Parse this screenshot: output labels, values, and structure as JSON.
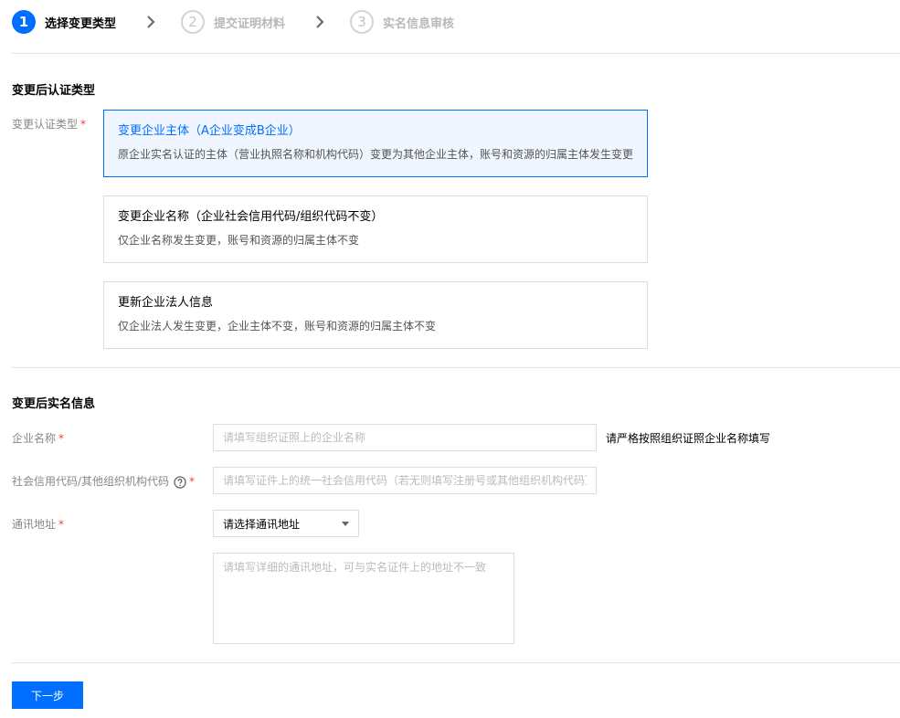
{
  "steps": [
    {
      "number": "1",
      "label": "选择变更类型"
    },
    {
      "number": "2",
      "label": "提交证明材料"
    },
    {
      "number": "3",
      "label": "实名信息审核"
    }
  ],
  "section1": {
    "title": "变更后认证类型",
    "field_label": "变更认证类型",
    "required_mark": "*",
    "options": [
      {
        "title": "变更企业主体（A企业变成B企业）",
        "desc": "原企业实名认证的主体（营业执照名称和机构代码）变更为其他企业主体，账号和资源的归属主体发生变更",
        "selected": true
      },
      {
        "title": "变更企业名称（企业社会信用代码/组织代码不变）",
        "desc": "仅企业名称发生变更，账号和资源的归属主体不变",
        "selected": false
      },
      {
        "title": "更新企业法人信息",
        "desc": "仅企业法人发生变更，企业主体不变，账号和资源的归属主体不变",
        "selected": false
      }
    ]
  },
  "section2": {
    "title": "变更后实名信息",
    "company_name": {
      "label": "企业名称",
      "required_mark": "*",
      "placeholder": "请填写组织证照上的企业名称",
      "hint": "请严格按照组织证照企业名称填写"
    },
    "credit_code": {
      "label": "社会信用代码/其他组织机构代码",
      "required_mark": "*",
      "placeholder": "请填写证件上的统一社会信用代码（若无则填写注册号或其他组织机构代码）",
      "help_icon": "question-circle-icon"
    },
    "address": {
      "label": "通讯地址",
      "required_mark": "*",
      "select_value": "请选择通讯地址",
      "detail_placeholder": "请填写详细的通讯地址，可与实名证件上的地址不一致"
    }
  },
  "footer": {
    "next_label": "下一步"
  },
  "colors": {
    "accent": "#006eff",
    "selected_bg": "#f0f6ff",
    "required": "#e54545",
    "border": "#dddddd"
  }
}
